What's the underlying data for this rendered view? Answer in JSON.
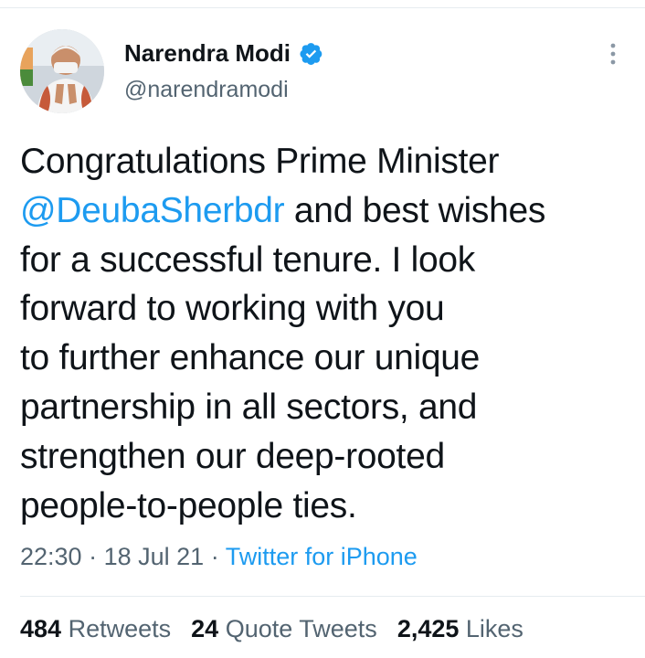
{
  "tweet": {
    "author": {
      "display_name": "Narendra Modi",
      "handle": "@narendramodi",
      "verified": true
    },
    "text_lines": [
      {
        "before": "Congratulations Prime Minister",
        "mention": "",
        "after": ""
      },
      {
        "before": "",
        "mention": "@DeubaSherbdr",
        "after": " and best wishes"
      },
      {
        "before": "for a successful tenure. I look",
        "mention": "",
        "after": ""
      },
      {
        "before": "forward to working with you",
        "mention": "",
        "after": ""
      },
      {
        "before": "to further enhance our unique",
        "mention": "",
        "after": ""
      },
      {
        "before": "partnership in all sectors, and",
        "mention": "",
        "after": ""
      },
      {
        "before": "strengthen our deep-rooted",
        "mention": "",
        "after": ""
      },
      {
        "before": "people-to-people ties.",
        "mention": "",
        "after": ""
      }
    ],
    "time": "22:30",
    "date": "18 Jul 21",
    "separator": "·",
    "source": "Twitter for iPhone",
    "stats": {
      "retweets_count": "484",
      "retweets_label": "Retweets",
      "quote_count": "24",
      "quote_label": "Quote Tweets",
      "likes_count": "2,425",
      "likes_label": "Likes"
    }
  },
  "icons": {
    "verified": "verified-badge-icon",
    "more": "more-vertical-icon"
  },
  "colors": {
    "link_blue": "#1d9bf0",
    "text_primary": "#0f1419",
    "text_secondary": "#536471",
    "divider": "#e6ecf0"
  }
}
